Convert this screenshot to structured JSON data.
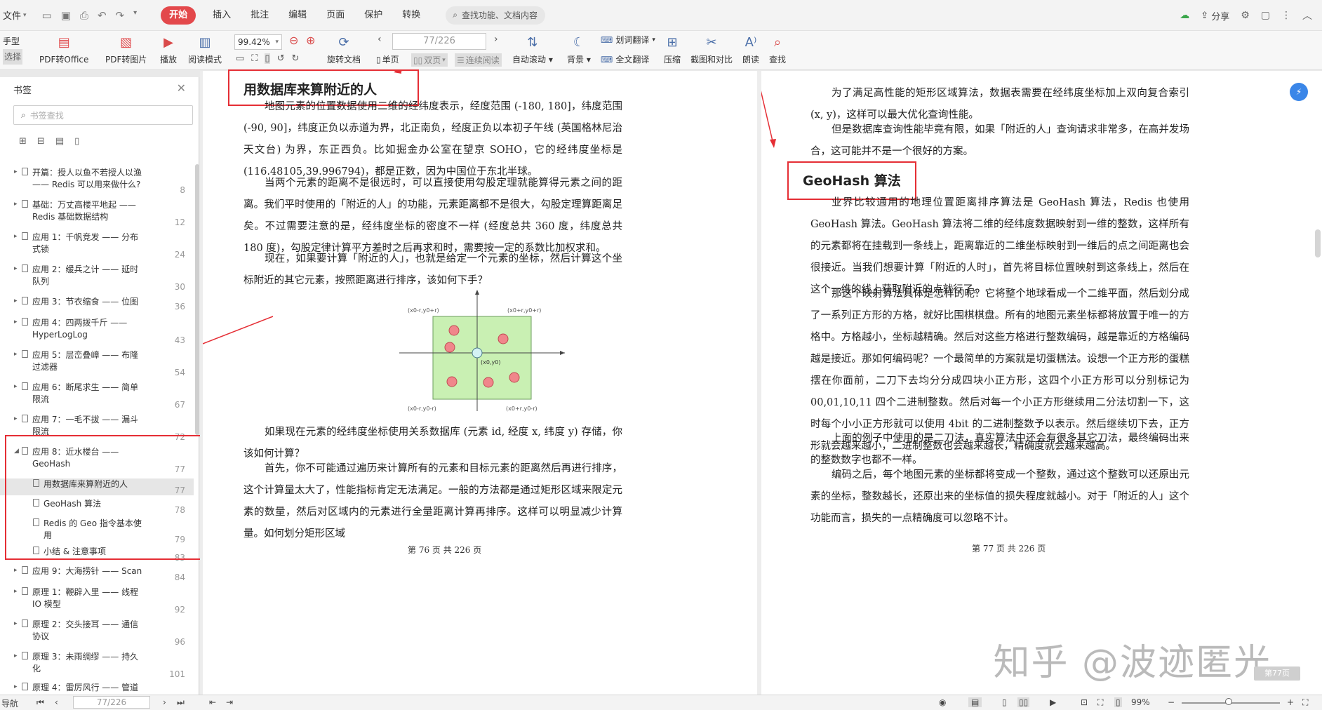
{
  "menubar": {
    "file_label": "文件",
    "menus": [
      "开始",
      "插入",
      "批注",
      "编辑",
      "页面",
      "保护",
      "转换"
    ],
    "search_placeholder": "查找功能、文档内容",
    "share_label": "分享"
  },
  "toolbar": {
    "hand": "手型",
    "select": "选择",
    "pdf_to_office": "PDF转Office",
    "pdf_to_image": "PDF转图片",
    "play": "播放",
    "read_mode": "阅读模式",
    "zoom": "99.42%",
    "rotate": "旋转文档",
    "page_value": "77/226",
    "single": "单页",
    "double": "双页",
    "continuous": "连续阅读",
    "auto_scroll": "自动滚动",
    "background": "背景",
    "word_translate": "划词翻译",
    "full_translate": "全文翻译",
    "compress": "压缩",
    "screenshot_compare": "截图和对比",
    "read_aloud": "朗读",
    "find": "查找"
  },
  "sidebar": {
    "title": "书签",
    "search_placeholder": "书签查找",
    "items": [
      {
        "text": "开篇：授人以鱼不若授人以渔 —— Redis 可以用来做什么?",
        "page": "8",
        "level": 0
      },
      {
        "text": "基础：万丈高楼平地起 —— Redis 基础数据结构",
        "page": "12",
        "level": 0
      },
      {
        "text": "应用 1：千帆竞发 —— 分布式锁",
        "page": "24",
        "level": 0
      },
      {
        "text": "应用 2：缓兵之计 —— 延时队列",
        "page": "30",
        "level": 0
      },
      {
        "text": "应用 3：节衣缩食 —— 位图",
        "page": "36",
        "level": 0
      },
      {
        "text": "应用 4：四两拨千斤 —— HyperLogLog",
        "page": "43",
        "level": 0
      },
      {
        "text": "应用 5：层峦叠嶂 —— 布隆过滤器",
        "page": "54",
        "level": 0
      },
      {
        "text": "应用 6：断尾求生 —— 简单限流",
        "page": "67",
        "level": 0
      },
      {
        "text": "应用 7：一毛不拔 —— 漏斗限流",
        "page": "72",
        "level": 0
      },
      {
        "text": "应用 8：近水楼台 —— GeoHash",
        "page": "77",
        "level": 0,
        "expanded": true
      },
      {
        "text": "用数据库来算附近的人",
        "page": "77",
        "level": 1,
        "selected": true
      },
      {
        "text": "GeoHash 算法",
        "page": "78",
        "level": 1
      },
      {
        "text": "Redis 的 Geo 指令基本使用",
        "page": "79",
        "level": 1
      },
      {
        "text": "小结 & 注意事项",
        "page": "83",
        "level": 1
      },
      {
        "text": "应用 9：大海捞针 —— Scan",
        "page": "84",
        "level": 0
      },
      {
        "text": "原理 1：鞭辟入里 —— 线程 IO 模型",
        "page": "92",
        "level": 0
      },
      {
        "text": "原理 2：交头接耳 —— 通信协议",
        "page": "96",
        "level": 0
      },
      {
        "text": "原理 3：未雨绸缪 —— 持久化",
        "page": "101",
        "level": 0
      },
      {
        "text": "原理 4：雷厉风行 —— 管道",
        "page": "",
        "level": 0
      }
    ]
  },
  "left_page": {
    "heading": "用数据库来算附近的人",
    "paragraphs": [
      "地图元素的位置数据使用二维的经纬度表示，经度范围 (-180, 180]，纬度范围 (-90, 90]，纬度正负以赤道为界，北正南负，经度正负以本初子午线 (英国格林尼治天文台) 为界，东正西负。比如掘金办公室在望京 SOHO，它的经纬度坐标是 (116.48105,39.996794)，都是正数，因为中国位于东北半球。",
      "当两个元素的距离不是很远时，可以直接使用勾股定理就能算得元素之间的距离。我们平时使用的「附近的人」的功能，元素距离都不是很大，勾股定理算距离足矣。不过需要注意的是，经纬度坐标的密度不一样 (经度总共 360 度，纬度总共 180 度)，勾股定律计算平方差时之后再求和时，需要按一定的系数比加权求和。",
      "现在，如果要计算「附近的人」，也就是给定一个元素的坐标，然后计算这个坐标附近的其它元素，按照距离进行排序，该如何下手？",
      "如果现在元素的经纬度坐标使用关系数据库 (元素 id, 经度 x, 纬度 y) 存储，你该如何计算？",
      "首先，你不可能通过遍历来计算所有的元素和目标元素的距离然后再进行排序，这个计算量太大了，性能指标肯定无法满足。一般的方法都是通过矩形区域来限定元素的数量，然后对区域内的元素进行全量距离计算再排序。这样可以明显减少计算量。如何划分矩形区域"
    ],
    "diagram": {
      "labels": [
        "(x0-r,y0+r)",
        "(x0+r,y0+r)",
        "(x0,y0)",
        "(x0-r,y0-r)",
        "(x0+r,y0-r)"
      ]
    },
    "footer": "第 76 页 共 226 页"
  },
  "right_page": {
    "top_fragment": "…",
    "paragraphs_top": [
      "为了满足高性能的矩形区域算法，数据表需要在经纬度坐标加上双向复合索引 (x, y)，这样可以最大优化查询性能。",
      "但是数据库查询性能毕竟有限，如果「附近的人」查询请求非常多，在高并发场合，这可能并不是一个很好的方案。"
    ],
    "heading": "GeoHash 算法",
    "paragraphs": [
      "业界比较通用的地理位置距离排序算法是 GeoHash 算法，Redis 也使用 GeoHash 算法。GeoHash 算法将二维的经纬度数据映射到一维的整数，这样所有的元素都将在挂载到一条线上，距离靠近的二维坐标映射到一维后的点之间距离也会很接近。当我们想要计算「附近的人时」，首先将目标位置映射到这条线上，然后在这个一维的线上获取附近的点就行了。",
      "那这个映射算法具体是怎样的呢？它将整个地球看成一个二维平面，然后划分成了一系列正方形的方格，就好比围棋棋盘。所有的地图元素坐标都将放置于唯一的方格中。方格越小，坐标越精确。然后对这些方格进行整数编码，越是靠近的方格编码越是接近。那如何编码呢？一个最简单的方案就是切蛋糕法。设想一个正方形的蛋糕摆在你面前，二刀下去均分分成四块小正方形，这四个小正方形可以分别标记为 00,01,10,11 四个二进制整数。然后对每一个小正方形继续用二分法切割一下，这时每个小小正方形就可以使用 4bit 的二进制整数予以表示。然后继续切下去，正方形就会越来越小，二进制整数也会越来越长，精确度就会越来越高。",
      "上面的例子中使用的是二刀法，真实算法中还会有很多其它刀法，最终编码出来的整数数字也都不一样。",
      "编码之后，每个地图元素的坐标都将变成一个整数，通过这个整数可以还原出元素的坐标，整数越长，还原出来的坐标值的损失程度就越小。对于「附近的人」这个功能而言，损失的一点精确度可以忽略不计。"
    ],
    "footer": "第 77 页 共 226 页"
  },
  "watermark": "知乎 @波迹匿光",
  "page_badge": "第77页",
  "statusbar": {
    "nav_label": "导航",
    "page_value": "77/226",
    "zoom": "99%"
  },
  "colors": {
    "accent_red": "#e52e35",
    "tab_active": "#e3484b",
    "blue_float": "#3a86e8",
    "diagram_fill": "#c9f0b3",
    "point_fill": "#f0868b"
  }
}
